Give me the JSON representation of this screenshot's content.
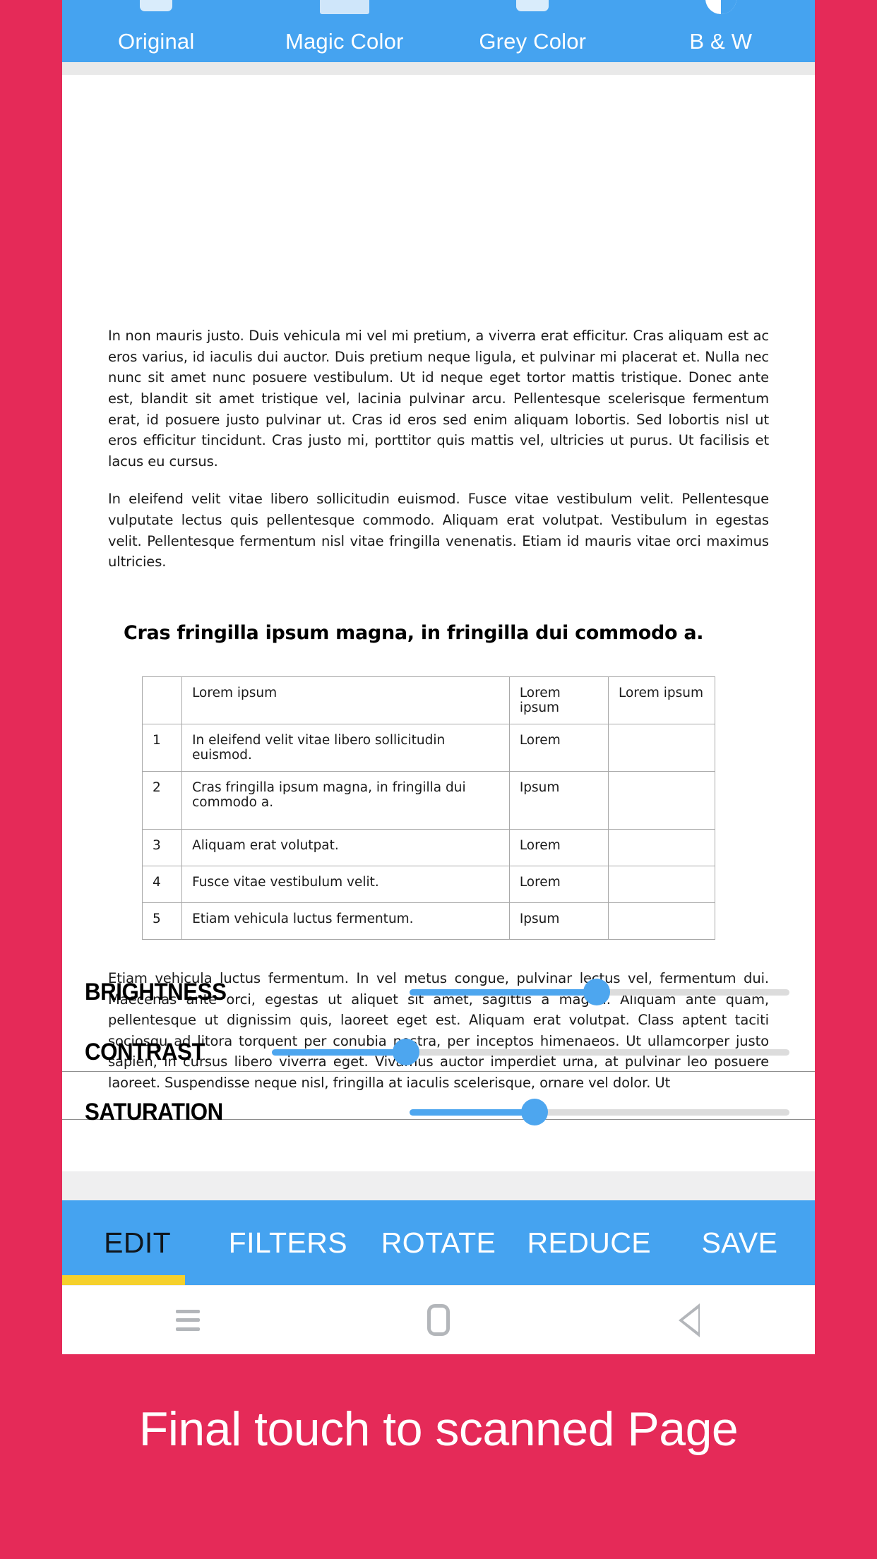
{
  "colors": {
    "background_pink": "#E52A58",
    "bar_blue": "#45A3F0",
    "accent_yellow": "#F5D02C",
    "slider_blue": "#4DA6EF",
    "slider_track_gray": "#DCDCDC"
  },
  "filter_bar": {
    "tabs": [
      {
        "label": "Original",
        "icon": "image-rounded-icon",
        "selected": true
      },
      {
        "label": "Magic Color",
        "icon": "color-bar-icon",
        "selected": false
      },
      {
        "label": "Grey Color",
        "icon": "grey-card-icon",
        "selected": false
      },
      {
        "label": "B & W",
        "icon": "half-circle-contrast-icon",
        "selected": false
      }
    ]
  },
  "document": {
    "paragraphs": [
      "In non mauris justo. Duis vehicula mi vel mi pretium, a viverra erat efficitur. Cras aliquam est ac eros varius, id iaculis dui auctor. Duis pretium neque ligula, et pulvinar mi placerat et. Nulla nec nunc sit amet nunc posuere vestibulum. Ut id neque eget tortor mattis tristique. Donec ante est, blandit sit amet tristique vel, lacinia pulvinar arcu. Pellentesque scelerisque fermentum erat, id posuere justo pulvinar ut. Cras id eros sed enim aliquam lobortis. Sed lobortis nisl ut eros efficitur tincidunt. Cras justo mi, porttitor quis mattis vel, ultricies ut purus. Ut facilisis et lacus eu cursus.",
      "In eleifend velit vitae libero sollicitudin euismod. Fusce vitae vestibulum velit. Pellentesque vulputate lectus quis pellentesque commodo. Aliquam erat volutpat. Vestibulum in egestas velit. Pellentesque fermentum nisl vitae fringilla venenatis. Etiam id mauris vitae orci maximus ultricies."
    ],
    "heading": "Cras fringilla ipsum magna, in fringilla dui commodo a.",
    "table": {
      "headers": [
        "",
        "Lorem ipsum",
        "Lorem ipsum",
        "Lorem ipsum"
      ],
      "rows": [
        {
          "num": "1",
          "main": "In eleifend velit vitae libero sollicitudin euismod.",
          "c": "Lorem",
          "d": ""
        },
        {
          "num": "2",
          "main": "Cras fringilla ipsum magna, in fringilla dui commodo a.",
          "c": "Ipsum",
          "d": ""
        },
        {
          "num": "3",
          "main": "Aliquam erat volutpat.",
          "c": "Lorem",
          "d": ""
        },
        {
          "num": "4",
          "main": "Fusce vitae vestibulum velit.",
          "c": "Lorem",
          "d": ""
        },
        {
          "num": "5",
          "main": "Etiam vehicula luctus fermentum.",
          "c": "Ipsum",
          "d": ""
        }
      ]
    },
    "paragraph_after_table": "Etiam vehicula luctus fermentum. In vel metus congue, pulvinar lectus vel, fermentum dui. Maecenas ante orci, egestas ut aliquet sit amet, sagittis a magna. Aliquam ante quam, pellentesque ut dignissim quis, laoreet eget est. Aliquam erat volutpat. Class aptent taciti sociosqu ad litora torquent per conubia nostra, per inceptos himenaeos. Ut ullamcorper justo sapien, in cursus libero viverra eget. Vivamus auctor imperdiet urna, at pulvinar leo posuere laoreet. Suspendisse neque nisl, fringilla at iaculis scelerisque, ornare vel dolor. Ut"
  },
  "adjustments": [
    {
      "label": "BRIGHTNESS",
      "value": 50
    },
    {
      "label": "CONTRAST",
      "value": 26
    },
    {
      "label": "SATURATION",
      "value": 33
    }
  ],
  "action_bar": {
    "tabs": [
      {
        "label": "EDIT",
        "active": true
      },
      {
        "label": "FILTERS",
        "active": false
      },
      {
        "label": "ROTATE",
        "active": false
      },
      {
        "label": "REDUCE",
        "active": false
      },
      {
        "label": "SAVE",
        "active": false
      }
    ]
  },
  "nav_bar": {
    "buttons": [
      {
        "icon": "menu-icon"
      },
      {
        "icon": "home-icon"
      },
      {
        "icon": "back-icon"
      }
    ]
  },
  "caption": "Final touch to scanned Page"
}
